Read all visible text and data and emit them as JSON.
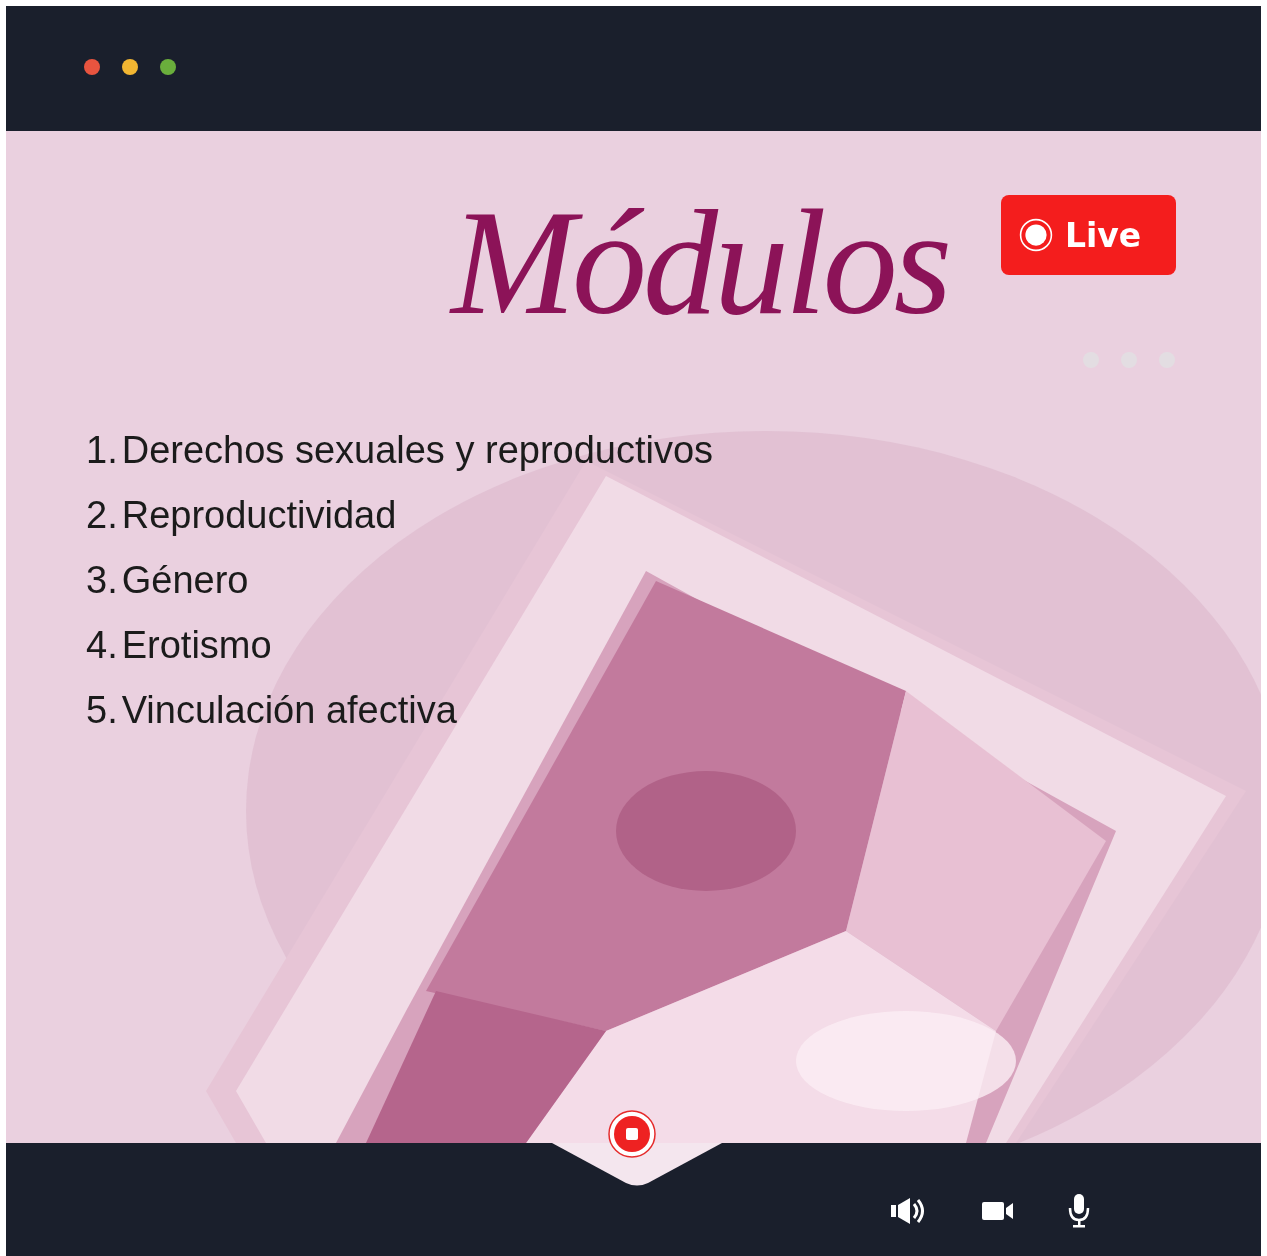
{
  "window_controls": [
    {
      "color": "#e8543f"
    },
    {
      "color": "#f2b632"
    },
    {
      "color": "#6aae3c"
    }
  ],
  "title": "Módulos",
  "live_badge": {
    "label": "Live"
  },
  "modules": [
    {
      "number": "1.",
      "text": "Derechos sexuales y reproductivos"
    },
    {
      "number": "2.",
      "text": "Reproductividad"
    },
    {
      "number": "3.",
      "text": "Género"
    },
    {
      "number": "4.",
      "text": "Erotismo"
    },
    {
      "number": "5.",
      "text": "Vinculación afectiva"
    }
  ]
}
